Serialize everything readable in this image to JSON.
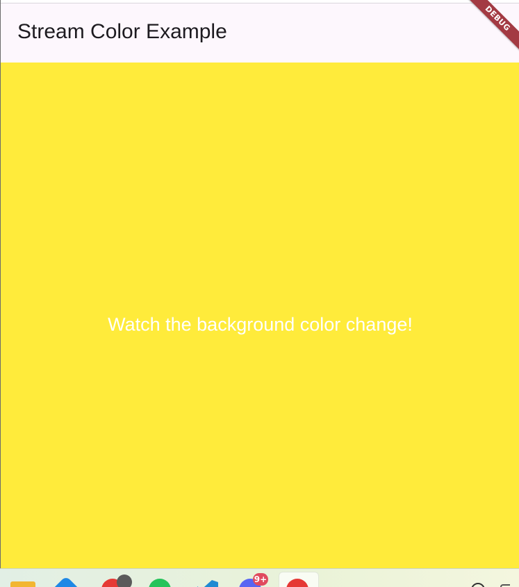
{
  "app": {
    "title": "Stream Color Example",
    "debug_banner": "DEBUG",
    "message": "Watch the background color change!",
    "background_color": "#ffeb3b",
    "appbar_color": "#fdf7fd",
    "message_color": "#ffffff"
  },
  "taskbar": {
    "icons": [
      "folder-icon",
      "microsoft-365-icon",
      "app-icon",
      "whatsapp-icon",
      "vscode-icon",
      "discord-icon",
      "chrome-icon"
    ],
    "notification_badge": "9+"
  }
}
